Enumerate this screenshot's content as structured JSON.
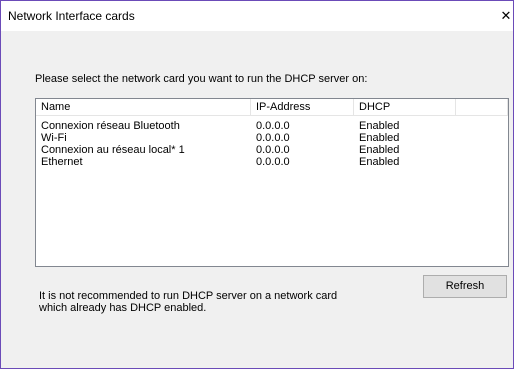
{
  "window": {
    "title": "Network Interface cards",
    "close_glyph": "✕"
  },
  "prompt": "Please select the network card you want to run the DHCP server on:",
  "table": {
    "columns": [
      "Name",
      "IP-Address",
      "DHCP"
    ],
    "rows": [
      [
        "Connexion réseau Bluetooth",
        "0.0.0.0",
        "Enabled"
      ],
      [
        "Wi-Fi",
        "0.0.0.0",
        "Enabled"
      ],
      [
        "Connexion au réseau local* 1",
        "0.0.0.0",
        "Enabled"
      ],
      [
        "Ethernet",
        "0.0.0.0",
        "Enabled"
      ]
    ]
  },
  "warning": {
    "line1": "It is not recommended to run DHCP server on a network card",
    "line2": "which already has DHCP enabled."
  },
  "buttons": {
    "refresh": "Refresh"
  },
  "colors": {
    "window_border": "#6b4bb8",
    "dialog_bg": "#f0f0f0"
  }
}
